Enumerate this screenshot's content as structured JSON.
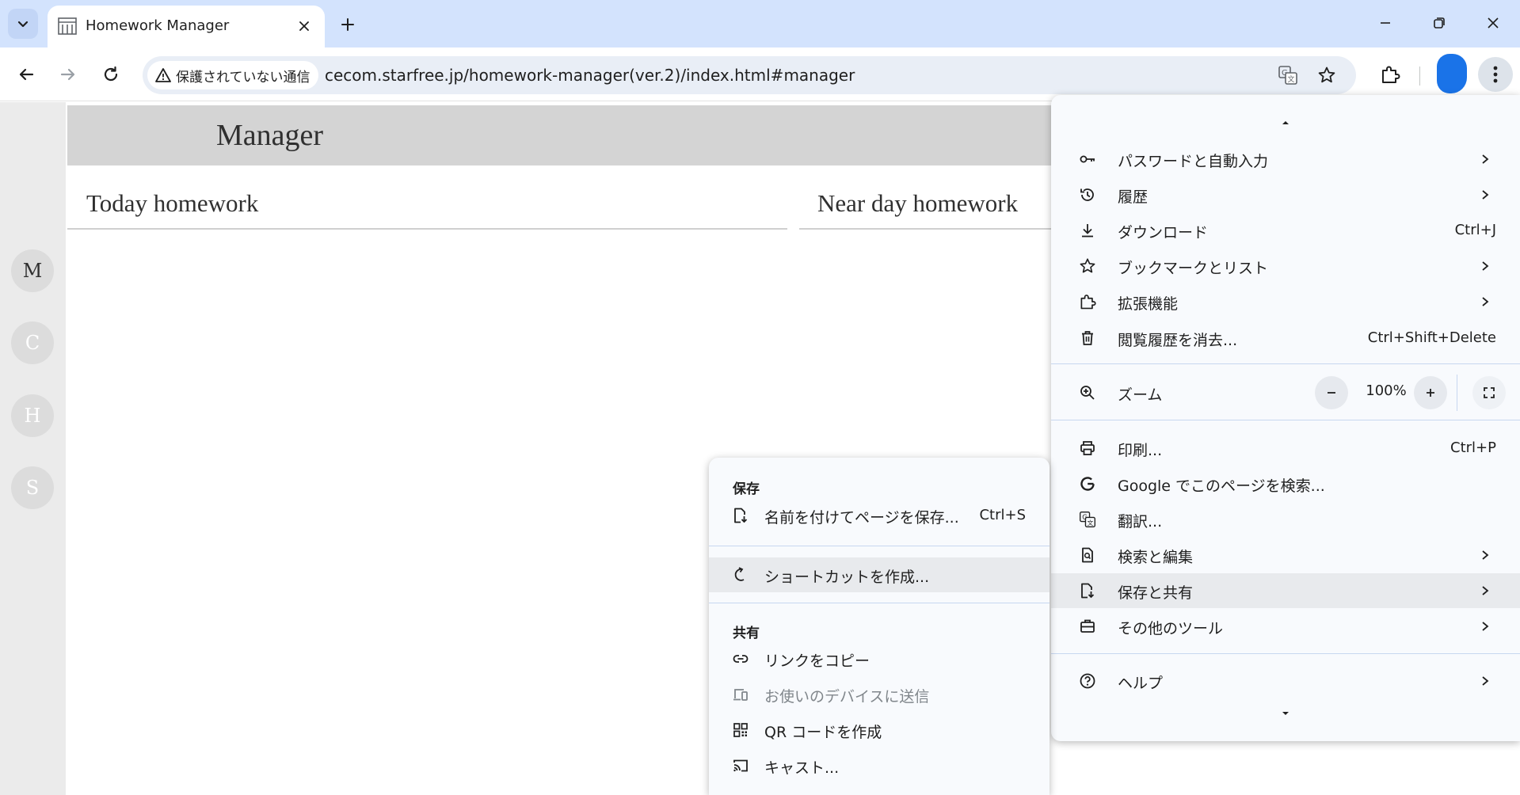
{
  "browser": {
    "tab": {
      "title": "Homework Manager",
      "favicon": "building-icon"
    },
    "address": {
      "security_label": "保護されていない通信",
      "url": "cecom.starfree.jp/homework-manager(ver.2)/index.html#manager"
    },
    "accent_color": "#1a73e8"
  },
  "page": {
    "title": "Manager",
    "sections": {
      "today": "Today homework",
      "near": "Near day homework"
    },
    "rail": [
      "M",
      "C",
      "H",
      "S"
    ]
  },
  "menu": {
    "items": [
      {
        "icon": "key-icon",
        "label": "パスワードと自動入力",
        "shortcut": null,
        "submenu": true
      },
      {
        "icon": "history-icon",
        "label": "履歴",
        "shortcut": null,
        "submenu": true
      },
      {
        "icon": "download-icon",
        "label": "ダウンロード",
        "shortcut": "Ctrl+J",
        "submenu": false
      },
      {
        "icon": "star-icon",
        "label": "ブックマークとリスト",
        "shortcut": null,
        "submenu": true
      },
      {
        "icon": "puzzle-icon",
        "label": "拡張機能",
        "shortcut": null,
        "submenu": true
      },
      {
        "icon": "trash-icon",
        "label": "閲覧履歴を消去...",
        "shortcut": "Ctrl+Shift+Delete",
        "submenu": false
      }
    ],
    "zoom": {
      "label": "ズーム",
      "value": "100%",
      "minus": "−",
      "plus": "+"
    },
    "items2": [
      {
        "icon": "printer-icon",
        "label": "印刷...",
        "shortcut": "Ctrl+P",
        "submenu": false
      },
      {
        "icon": "google-icon",
        "label": "Google でこのページを検索...",
        "shortcut": null,
        "submenu": false
      },
      {
        "icon": "translate-icon",
        "label": "翻訳...",
        "shortcut": null,
        "submenu": false
      },
      {
        "icon": "find-edit-icon",
        "label": "検索と編集",
        "shortcut": null,
        "submenu": true
      },
      {
        "icon": "save-share-icon",
        "label": "保存と共有",
        "shortcut": null,
        "submenu": true,
        "highlighted": true
      },
      {
        "icon": "toolbox-icon",
        "label": "その他のツール",
        "shortcut": null,
        "submenu": true
      }
    ],
    "help": {
      "icon": "help-icon",
      "label": "ヘルプ",
      "submenu": true
    }
  },
  "submenu": {
    "save_heading": "保存",
    "save_page": {
      "label": "名前を付けてページを保存...",
      "shortcut": "Ctrl+S"
    },
    "create_shortcut": {
      "label": "ショートカットを作成..."
    },
    "share_heading": "共有",
    "copy_link": {
      "label": "リンクをコピー"
    },
    "send_devices": {
      "label": "お使いのデバイスに送信",
      "disabled": true
    },
    "qr_code": {
      "label": "QR コードを作成"
    },
    "cast": {
      "label": "キャスト..."
    }
  }
}
